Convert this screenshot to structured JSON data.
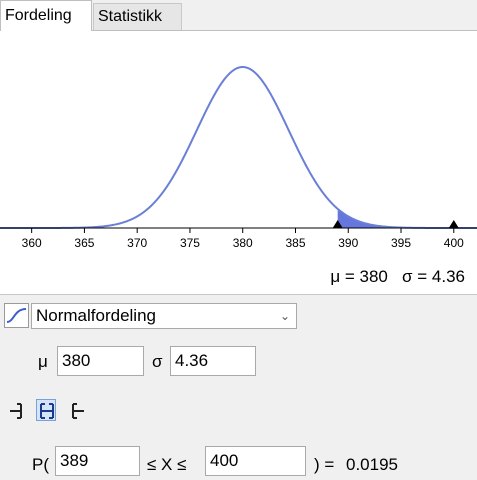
{
  "tabs": [
    {
      "label": "Fordeling",
      "active": true
    },
    {
      "label": "Statistikk",
      "active": false
    }
  ],
  "plot": {
    "x_ticks": [
      "360",
      "365",
      "370",
      "375",
      "380",
      "385",
      "390",
      "395",
      "400"
    ],
    "mu_readout": "μ = 380",
    "sigma_readout": "σ = 4.36",
    "curve_color": "#6a7fd6",
    "shade_color": "#4a5fd8",
    "shade_from": 389,
    "shade_to": 400
  },
  "distribution": {
    "icon": "normal-curve-icon",
    "selected": "Normalfordeling"
  },
  "parameters": {
    "mu_label": "μ",
    "mu_value": "380",
    "sigma_label": "σ",
    "sigma_value": "4.36"
  },
  "probability_modes": {
    "icons": [
      "left-sided-icon",
      "interval-icon",
      "right-sided-icon"
    ],
    "active": "interval-icon"
  },
  "probability": {
    "prefix": "P(",
    "lower": "389",
    "middle": "≤ X ≤",
    "upper": "400",
    "suffix": ") =",
    "result": "0.0195"
  }
}
